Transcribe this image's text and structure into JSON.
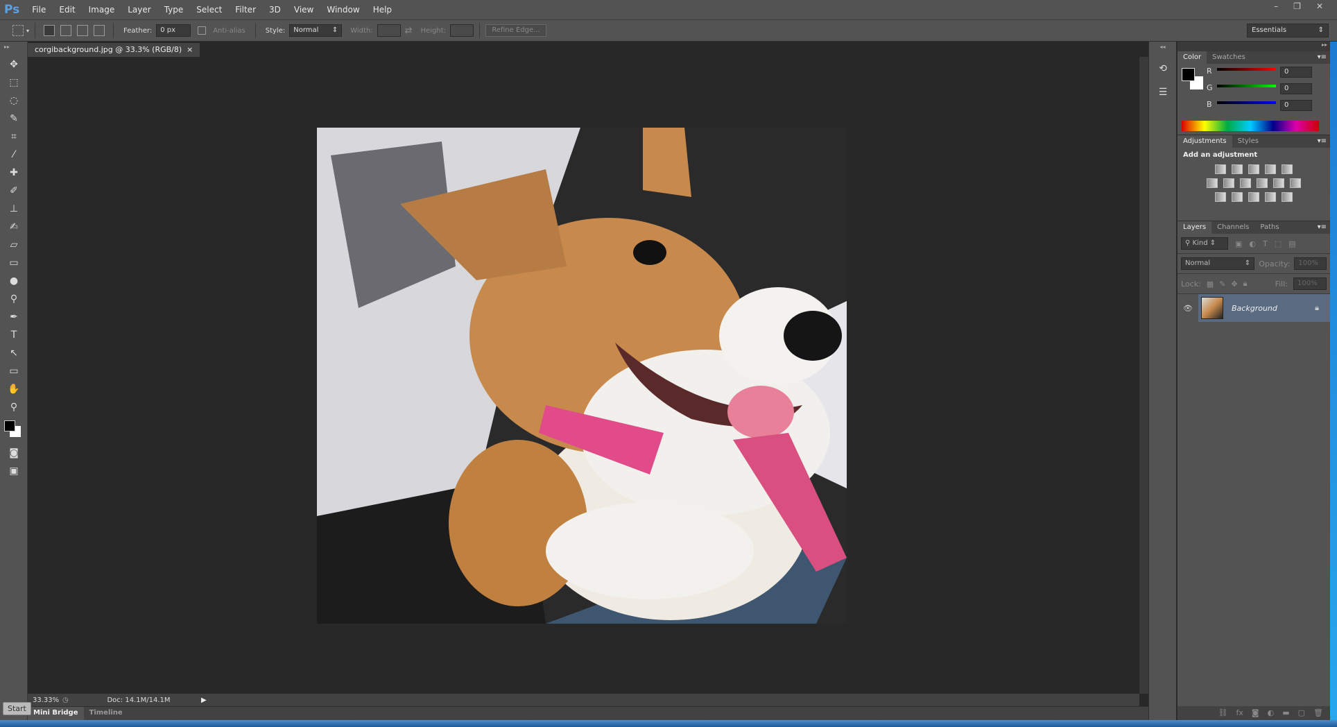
{
  "app": {
    "logo": "Ps",
    "menu": [
      "File",
      "Edit",
      "Image",
      "Layer",
      "Type",
      "Select",
      "Filter",
      "3D",
      "View",
      "Window",
      "Help"
    ],
    "window_controls": [
      "–",
      "❐",
      "✕"
    ]
  },
  "options": {
    "feather_label": "Feather:",
    "feather_value": "0 px",
    "antialias_label": "Anti-alias",
    "style_label": "Style:",
    "style_value": "Normal",
    "width_label": "Width:",
    "height_label": "Height:",
    "refine_edge": "Refine Edge...",
    "workspace": "Essentials"
  },
  "document": {
    "tab_title": "corgibackground.jpg @ 33.3% (RGB/8)",
    "close": "×",
    "zoom": "33.33%",
    "doc_size": "Doc: 14.1M/14.1M"
  },
  "tools": [
    "move",
    "marquee",
    "lasso",
    "quick-select",
    "crop",
    "eyedropper",
    "healing",
    "brush",
    "stamp",
    "history-brush",
    "eraser",
    "gradient",
    "blur",
    "dodge",
    "pen",
    "type",
    "path-select",
    "shape",
    "hand",
    "zoom"
  ],
  "color_panel": {
    "tabs": [
      "Color",
      "Swatches"
    ],
    "r_label": "R",
    "g_label": "G",
    "b_label": "B",
    "r": "0",
    "g": "0",
    "b": "0",
    "foreground": "#000000",
    "background": "#ffffff"
  },
  "adjustments_panel": {
    "tabs": [
      "Adjustments",
      "Styles"
    ],
    "heading": "Add an adjustment"
  },
  "layers_panel": {
    "tabs": [
      "Layers",
      "Channels",
      "Paths"
    ],
    "filter_kind": "Kind",
    "blend_mode": "Normal",
    "opacity_label": "Opacity:",
    "opacity": "100%",
    "lock_label": "Lock:",
    "fill_label": "Fill:",
    "fill": "100%",
    "layers": [
      {
        "name": "Background",
        "visible": true,
        "locked": true
      }
    ]
  },
  "bottom_tabs": [
    "Mini Bridge",
    "Timeline"
  ],
  "taskbar": {
    "start": "Start"
  }
}
